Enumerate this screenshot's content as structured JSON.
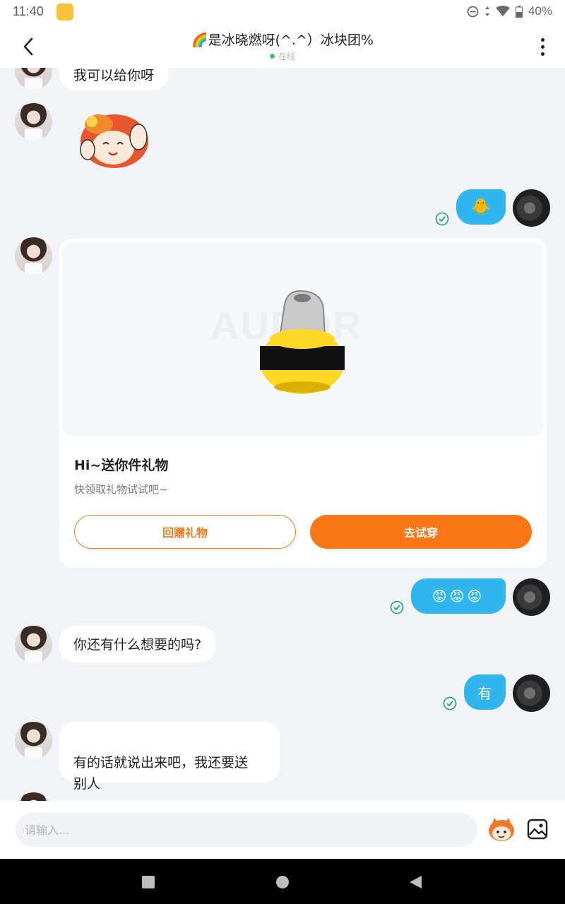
{
  "status_bar": {
    "time": "11:40",
    "battery": "40%"
  },
  "header": {
    "title": "🌈是冰晓燃呀(^.^）冰块团%",
    "status": "在线"
  },
  "messages": [
    {
      "side": "left",
      "type": "text",
      "text": "我可以给你呀"
    },
    {
      "side": "left",
      "type": "sticker",
      "sticker": "cartoon-girl-sticker"
    },
    {
      "side": "right",
      "type": "emoji",
      "emoji": "🐥",
      "status": "read"
    },
    {
      "side": "left",
      "type": "gift",
      "title": "Hi~送你件礼物",
      "subtitle": "快领取礼物试试吧~",
      "watermark": "AUDOR",
      "return_label": "回赠礼物",
      "try_label": "去试穿"
    },
    {
      "side": "right",
      "type": "emoji",
      "emoji": "😡😡😡",
      "status": "read"
    },
    {
      "side": "left",
      "type": "text",
      "text": "你还有什么想要的吗?"
    },
    {
      "side": "right",
      "type": "text",
      "text": "有",
      "status": "read"
    },
    {
      "side": "left",
      "type": "text",
      "text": "有的话就说出来吧，我还要送\n别人"
    }
  ],
  "input": {
    "placeholder": "请输入..."
  },
  "icons": {
    "back": "back-arrow-icon",
    "more": "more-vertical-icon",
    "emoji": "emoji-face-icon",
    "image": "image-icon",
    "check": "check-circle-icon"
  },
  "colors": {
    "accent": "#2fb6ee",
    "orange": "#fb7615",
    "check": "#1fa37a",
    "online": "#3cc36b"
  }
}
